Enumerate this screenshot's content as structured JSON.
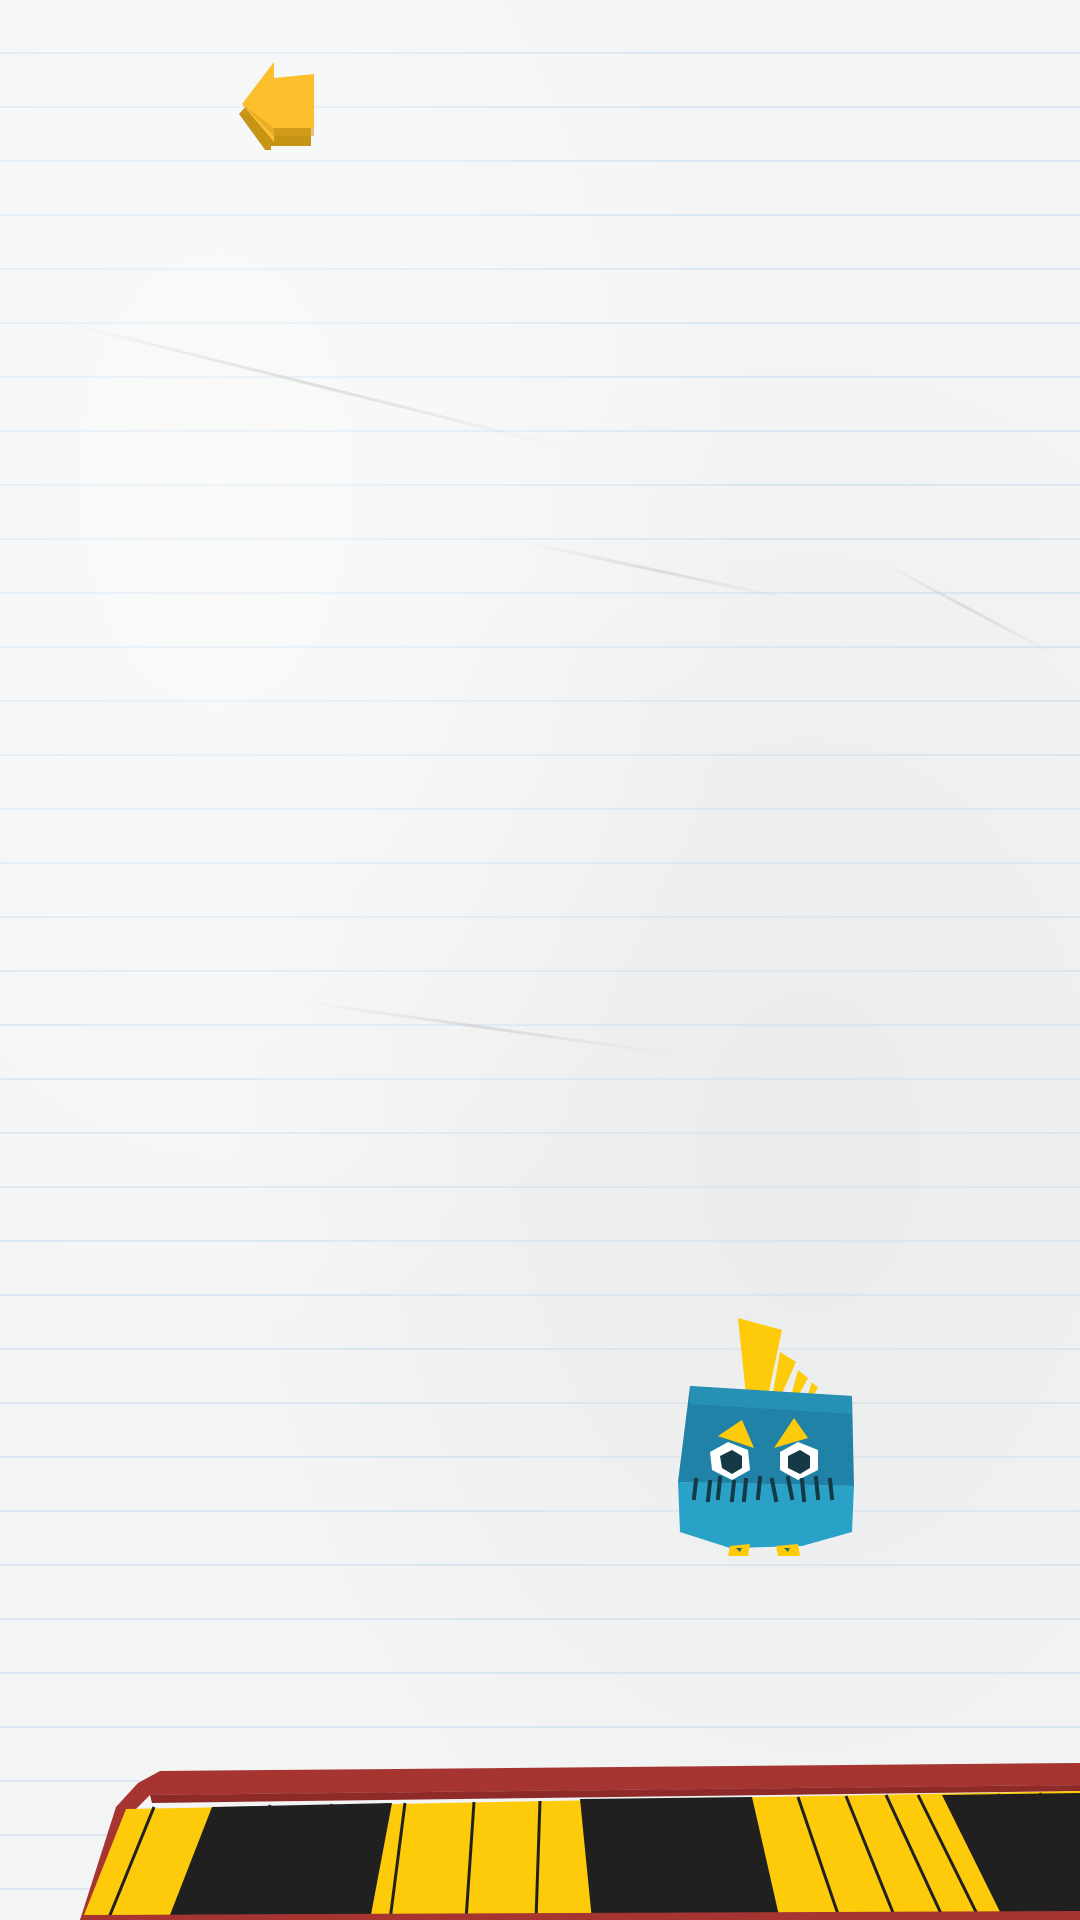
{
  "screen": {
    "name": "game-play-screen",
    "background": "lined-notebook-paper"
  },
  "back_button": {
    "icon": "arrow-left-icon",
    "color": "#fdbf2d",
    "shadow_color": "#c79516"
  },
  "character": {
    "icon": "blue-monster-icon",
    "body_color": "#2496b9",
    "accent_color": "#fecb0a",
    "eye_color": "#ffffff"
  },
  "keyboard": {
    "icon": "piano-keyboard-icon",
    "frame_color": "#a63532",
    "key_colors": [
      "yellow",
      "black",
      "black",
      "black",
      "yellow",
      "yellow",
      "yellow",
      "yellow",
      "black",
      "black",
      "black",
      "yellow",
      "yellow",
      "yellow",
      "yellow",
      "black",
      "black",
      "black"
    ],
    "yellow": "#fecb0a",
    "black": "#202020"
  }
}
